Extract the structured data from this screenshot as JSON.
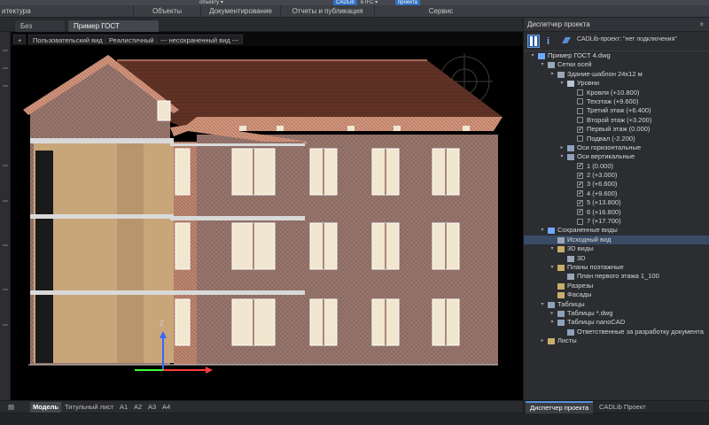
{
  "ribbon": {
    "groups": [
      "итектура",
      "Объекты",
      "Документирование",
      "Отчеты и публикация",
      "Сервис"
    ],
    "chips": [
      "объекту ▾",
      "CADLib",
      "в IFC ▾",
      "проекта"
    ]
  },
  "doc_tabs": [
    {
      "label": "Без имени0*",
      "active": false
    },
    {
      "label": "Пример ГОСТ 4.dwg*",
      "active": true
    }
  ],
  "viewport": {
    "controls": [
      "+",
      "Пользовательский вид",
      "Реалистичный",
      "--- несохраненный вид ---"
    ],
    "axis_z": "Z"
  },
  "layout_tabs": [
    {
      "label": "Модель",
      "active": true
    },
    {
      "label": "Титульный лист",
      "active": false
    },
    {
      "label": "A1",
      "active": false
    },
    {
      "label": "A2",
      "active": false
    },
    {
      "label": "A3",
      "active": false
    },
    {
      "label": "A4",
      "active": false
    }
  ],
  "panel": {
    "title": "Диспетчер проекта",
    "close": "×",
    "cad_status": "CADLib-проект: \"нет подключения\"",
    "tabs": [
      {
        "label": "Диспетчер проекта",
        "active": true
      },
      {
        "label": "CADLib Проект",
        "active": false
      }
    ],
    "tree": [
      {
        "label": "Пример ГОСТ 4.dwg",
        "level": 0,
        "arrow": "▾",
        "icon": "file-icon"
      },
      {
        "label": "Сетки осей",
        "level": 1,
        "arrow": "▾",
        "icon": "grid-icon"
      },
      {
        "label": "Здание-шаблон 24x12 м",
        "level": 2,
        "arrow": "▾",
        "icon": "grid-icon"
      },
      {
        "label": "Уровни",
        "level": 3,
        "arrow": "▾",
        "icon": "levels-icon"
      },
      {
        "label": "Кровля (+10.800)",
        "level": 4,
        "checkbox": false
      },
      {
        "label": "Техэтаж (+9.600)",
        "level": 4,
        "checkbox": false
      },
      {
        "label": "Третий этаж (+6.400)",
        "level": 4,
        "checkbox": false
      },
      {
        "label": "Второй этаж (+3.200)",
        "level": 4,
        "checkbox": false
      },
      {
        "label": "Первый этаж (0.000)",
        "level": 4,
        "checkbox": true
      },
      {
        "label": "Подвал (-2.200)",
        "level": 4,
        "checkbox": false
      },
      {
        "label": "Оси горизонтальные",
        "level": 3,
        "arrow": "▸",
        "icon": "axes-icon"
      },
      {
        "label": "Оси вертикальные",
        "level": 3,
        "arrow": "▾",
        "icon": "axes-icon"
      },
      {
        "label": "1 (0.000)",
        "level": 4,
        "checkbox": true
      },
      {
        "label": "2 (+3.000)",
        "level": 4,
        "checkbox": true
      },
      {
        "label": "3 (+6.600)",
        "level": 4,
        "checkbox": true
      },
      {
        "label": "4 (+9.600)",
        "level": 4,
        "checkbox": true
      },
      {
        "label": "5 (+13.800)",
        "level": 4,
        "checkbox": true
      },
      {
        "label": "6 (+16.800)",
        "level": 4,
        "checkbox": true
      },
      {
        "label": "7 (+17.700)",
        "level": 4,
        "checkbox": false
      },
      {
        "label": "Сохраненные виды",
        "level": 1,
        "arrow": "▾",
        "icon": "camera-icon"
      },
      {
        "label": "Исходный вид",
        "level": 2,
        "icon": "view-icon",
        "selected": true
      },
      {
        "label": "3D виды",
        "level": 2,
        "arrow": "▾",
        "icon": "folder-icon"
      },
      {
        "label": "3D",
        "level": 3,
        "icon": "cube-icon"
      },
      {
        "label": "Планы поэтажные",
        "level": 2,
        "arrow": "▾",
        "icon": "folder-icon"
      },
      {
        "label": "План первого этажа 1_100",
        "level": 3,
        "icon": "plan-icon"
      },
      {
        "label": "Разрезы",
        "level": 2,
        "icon": "folder-icon"
      },
      {
        "label": "Фасады",
        "level": 2,
        "icon": "folder-icon"
      },
      {
        "label": "Таблицы",
        "level": 1,
        "arrow": "▾",
        "icon": "table-icon"
      },
      {
        "label": "Таблицы *.dwg",
        "level": 2,
        "arrow": "▸",
        "icon": "table-icon"
      },
      {
        "label": "Таблицы nanoCAD",
        "level": 2,
        "arrow": "▾",
        "icon": "table-icon"
      },
      {
        "label": "Ответственные за разработку документа",
        "level": 3,
        "icon": "table-icon"
      },
      {
        "label": "Листы",
        "level": 1,
        "arrow": "▸",
        "icon": "folder-icon"
      }
    ]
  },
  "colors": {
    "accent": "#2f6fc1",
    "roof": "#5a2f22",
    "wall": "#8c6b62",
    "loggia": "#c9a57a",
    "selection": "#3a4b66"
  }
}
